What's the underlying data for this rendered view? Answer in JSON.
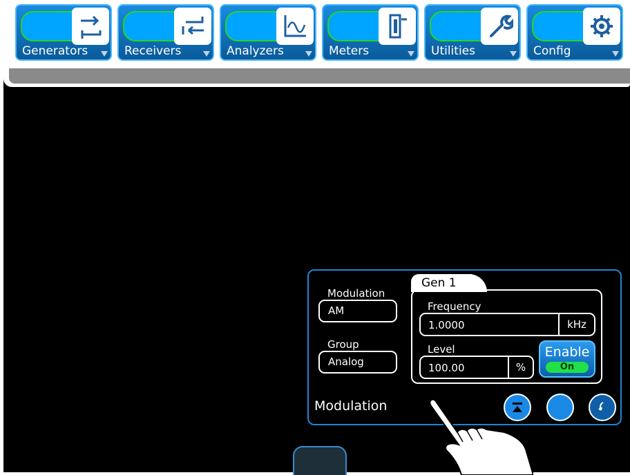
{
  "toolbar": {
    "tabs": [
      {
        "label": "Generators",
        "icon": "generators-arrows-icon"
      },
      {
        "label": "Receivers",
        "icon": "receivers-arrows-icon"
      },
      {
        "label": "Analyzers",
        "icon": "waveform-graph-icon"
      },
      {
        "label": "Meters",
        "icon": "meter-icon"
      },
      {
        "label": "Utilities",
        "icon": "wrench-icon"
      },
      {
        "label": "Config",
        "icon": "gear-icon"
      }
    ]
  },
  "panel": {
    "title": "Modulation",
    "modulation": {
      "label": "Modulation",
      "value": "AM"
    },
    "group": {
      "label": "Group",
      "value": "Analog"
    },
    "gen": {
      "tab_label": "Gen 1",
      "frequency": {
        "label": "Frequency",
        "value": "1.0000",
        "unit": "kHz"
      },
      "level": {
        "label": "Level",
        "value": "100.00",
        "unit": "%"
      },
      "enable": {
        "label": "Enable",
        "state": "On"
      }
    }
  },
  "colors": {
    "accent_blue": "#1a89e6",
    "tab_green_outline": "#26d626",
    "enable_on": "#21e04a"
  }
}
